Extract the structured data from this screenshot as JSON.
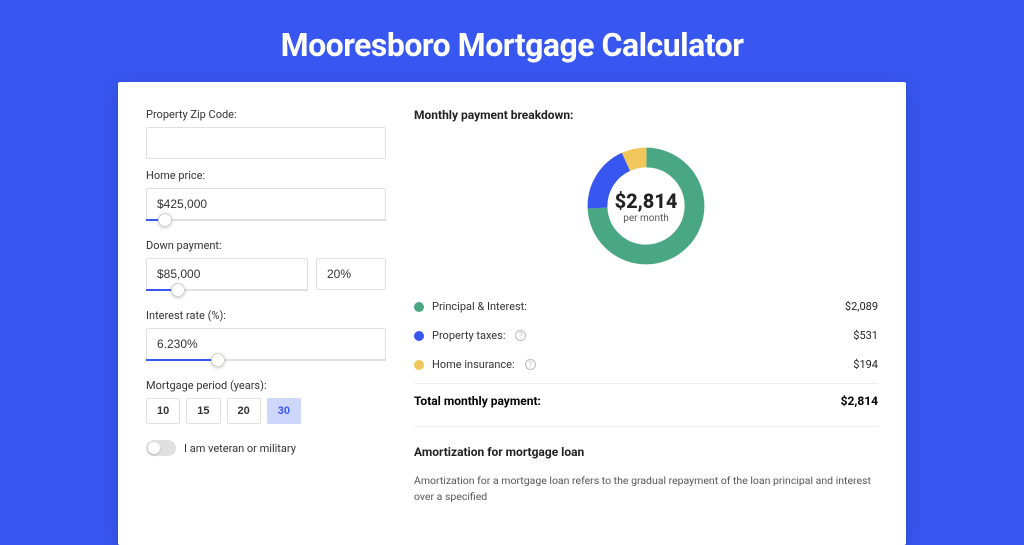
{
  "page": {
    "title": "Mooresboro Mortgage Calculator"
  },
  "form": {
    "zip_label": "Property Zip Code:",
    "zip_value": "",
    "home_price_label": "Home price:",
    "home_price_value": "$425,000",
    "home_price_slider_pct": 8,
    "down_label": "Down payment:",
    "down_amount_value": "$85,000",
    "down_pct_value": "20%",
    "down_slider_pct": 20,
    "rate_label": "Interest rate (%):",
    "rate_value": "6.230%",
    "rate_slider_pct": 30,
    "period_label": "Mortgage period (years):",
    "periods": [
      "10",
      "15",
      "20",
      "30"
    ],
    "period_active": "30",
    "veteran_label": "I am veteran or military",
    "veteran_on": false
  },
  "breakdown": {
    "header": "Monthly payment breakdown:",
    "center_amount": "$2,814",
    "center_sub": "per month",
    "items": [
      {
        "label": "Principal & Interest:",
        "value": "$2,089",
        "color": "#4aa783",
        "info": false
      },
      {
        "label": "Property taxes:",
        "value": "$531",
        "color": "#3857f0",
        "info": true
      },
      {
        "label": "Home insurance:",
        "value": "$194",
        "color": "#f1c75b",
        "info": true
      }
    ],
    "total_label": "Total monthly payment:",
    "total_value": "$2,814"
  },
  "chart_data": {
    "type": "pie",
    "title": "Monthly payment breakdown",
    "categories": [
      "Principal & Interest",
      "Property taxes",
      "Home insurance"
    ],
    "values": [
      2089,
      531,
      194
    ],
    "colors": [
      "#4aa783",
      "#3857f0",
      "#f1c75b"
    ],
    "center_label": "$2,814 per month"
  },
  "amortization": {
    "header": "Amortization for mortgage loan",
    "body": "Amortization for a mortgage loan refers to the gradual repayment of the loan principal and interest over a specified"
  }
}
